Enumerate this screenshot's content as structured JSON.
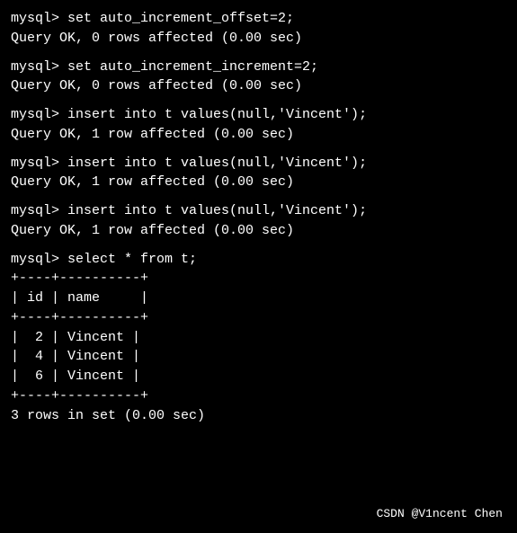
{
  "terminal": {
    "background": "#000000",
    "text_color": "#ffffff",
    "lines": [
      {
        "type": "prompt",
        "text": "mysql> set auto_increment_offset=2;"
      },
      {
        "type": "result",
        "text": "Query OK, 0 rows affected (0.00 sec)"
      },
      {
        "type": "spacer"
      },
      {
        "type": "prompt",
        "text": "mysql> set auto_increment_increment=2;"
      },
      {
        "type": "result",
        "text": "Query OK, 0 rows affected (0.00 sec)"
      },
      {
        "type": "spacer"
      },
      {
        "type": "prompt",
        "text": "mysql> insert into t values(null,'Vincent');"
      },
      {
        "type": "result",
        "text": "Query OK, 1 row affected (0.00 sec)"
      },
      {
        "type": "spacer"
      },
      {
        "type": "prompt",
        "text": "mysql> insert into t values(null,'Vincent');"
      },
      {
        "type": "result",
        "text": "Query OK, 1 row affected (0.00 sec)"
      },
      {
        "type": "spacer"
      },
      {
        "type": "prompt",
        "text": "mysql> insert into t values(null,'Vincent');"
      },
      {
        "type": "result",
        "text": "Query OK, 1 row affected (0.00 sec)"
      },
      {
        "type": "spacer"
      },
      {
        "type": "prompt",
        "text": "mysql> select * from t;"
      },
      {
        "type": "table_border",
        "text": "+----+----------+"
      },
      {
        "type": "table_header",
        "text": "| id | name     |"
      },
      {
        "type": "table_border",
        "text": "+----+----------+"
      },
      {
        "type": "table_row",
        "text": "|  2 | Vincent |"
      },
      {
        "type": "table_row",
        "text": "|  4 | Vincent |"
      },
      {
        "type": "table_row",
        "text": "|  6 | Vincent |"
      },
      {
        "type": "table_border",
        "text": "+----+----------+"
      },
      {
        "type": "result",
        "text": "3 rows in set (0.00 sec)"
      }
    ],
    "watermark": "CSDN @V1ncent Chen"
  }
}
